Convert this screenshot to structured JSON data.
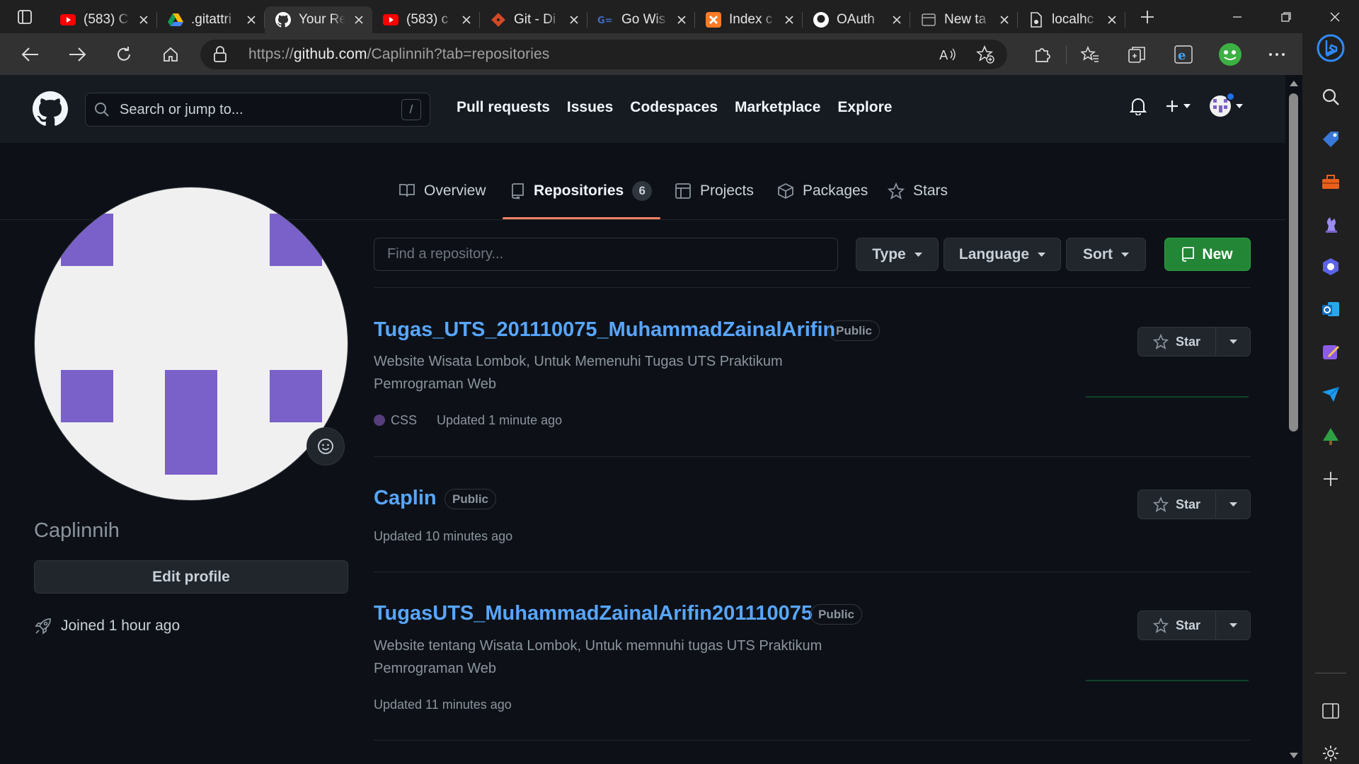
{
  "browser": {
    "tabs": [
      {
        "title": "(583) C",
        "icon": "youtube-icon"
      },
      {
        "title": ".gitattri",
        "icon": "google-drive-icon"
      },
      {
        "title": "Your Re",
        "icon": "github-icon",
        "active": true
      },
      {
        "title": "(583) c",
        "icon": "youtube-icon"
      },
      {
        "title": "Git - Di",
        "icon": "git-icon"
      },
      {
        "title": "Go Wis",
        "icon": "go-icon"
      },
      {
        "title": "Index c",
        "icon": "xampp-icon"
      },
      {
        "title": "OAuth",
        "icon": "github-icon"
      },
      {
        "title": "New ta",
        "icon": "newtab-icon"
      },
      {
        "title": "localhc",
        "icon": "file-icon"
      }
    ],
    "url_prefix": "https://",
    "url_host": "github.com",
    "url_path": "/Caplinnih?tab=repositories"
  },
  "github": {
    "search_placeholder": "Search or jump to...",
    "search_shortcut": "/",
    "nav": [
      "Pull requests",
      "Issues",
      "Codespaces",
      "Marketplace",
      "Explore"
    ],
    "profile_tabs": {
      "overview": "Overview",
      "repositories": "Repositories",
      "repositories_count": "6",
      "projects": "Projects",
      "packages": "Packages",
      "stars": "Stars"
    },
    "profile": {
      "username": "Caplinnih",
      "edit_label": "Edit profile",
      "joined": "Joined 1 hour ago"
    },
    "filters": {
      "find_placeholder": "Find a repository...",
      "type": "Type",
      "language": "Language",
      "sort": "Sort",
      "new": "New"
    },
    "repos": [
      {
        "name": "Tugas_UTS_201110075_MuhammadZainalArifin",
        "visibility": "Public",
        "description": "Website Wisata Lombok, Untuk Memenuhi Tugas UTS Praktikum Pemrograman Web",
        "language": "CSS",
        "language_color": "#563d7c",
        "updated": "Updated 1 minute ago",
        "star_label": "Star"
      },
      {
        "name": "Caplin",
        "visibility": "Public",
        "description": "",
        "updated": "Updated 10 minutes ago",
        "star_label": "Star"
      },
      {
        "name": "TugasUTS_MuhammadZainalArifin201110075",
        "visibility": "Public",
        "description": "Website tentang Wisata Lombok, Untuk memnuhi tugas UTS Praktikum Pemrograman Web",
        "updated": "Updated 11 minutes ago",
        "star_label": "Star"
      }
    ]
  },
  "colors": {
    "link": "#58a6ff",
    "accent_underline": "#f78166",
    "new_button": "#238636",
    "avatar_purple": "#7a60c9"
  }
}
